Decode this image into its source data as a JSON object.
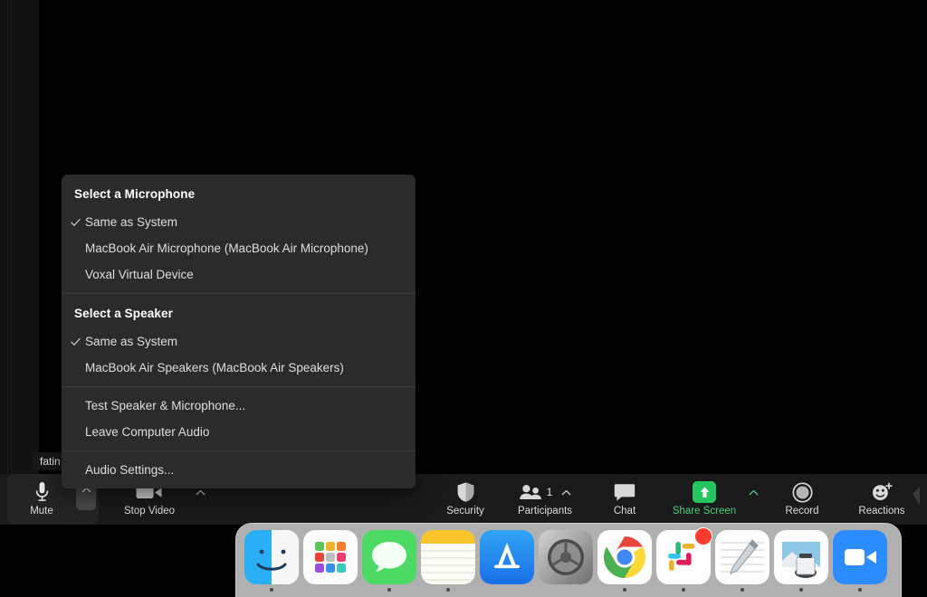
{
  "app": {
    "name": "Zoom Meeting",
    "participant_name_chip": "fatin"
  },
  "audio_menu": {
    "sections": [
      {
        "header": "Select a Microphone",
        "items": [
          {
            "label": "Same as System",
            "checked": true
          },
          {
            "label": "MacBook Air Microphone (MacBook Air Microphone)",
            "checked": false
          },
          {
            "label": "Voxal Virtual Device",
            "checked": false
          }
        ]
      },
      {
        "header": "Select a Speaker",
        "items": [
          {
            "label": "Same as System",
            "checked": true
          },
          {
            "label": "MacBook Air Speakers (MacBook Air Speakers)",
            "checked": false
          }
        ]
      },
      {
        "header": "",
        "items": [
          {
            "label": "Test Speaker & Microphone...",
            "checked": false
          },
          {
            "label": "Leave Computer Audio",
            "checked": false
          }
        ]
      },
      {
        "header": "",
        "items": [
          {
            "label": "Audio Settings...",
            "checked": false
          }
        ]
      }
    ]
  },
  "toolbar": {
    "mute": {
      "label": "Mute",
      "icon": "microphone-icon",
      "caret": "chevron-up-icon",
      "caret_active": true
    },
    "video": {
      "label": "Stop Video",
      "icon": "video-camera-icon",
      "caret": "chevron-up-icon"
    },
    "security": {
      "label": "Security",
      "icon": "shield-icon"
    },
    "participants": {
      "label": "Participants",
      "icon": "people-icon",
      "count": "1",
      "caret": "chevron-up-icon"
    },
    "chat": {
      "label": "Chat",
      "icon": "speech-bubble-icon"
    },
    "share_screen": {
      "label": "Share Screen",
      "icon": "up-arrow-icon",
      "caret": "chevron-up-icon",
      "accent": "#22c55e"
    },
    "record": {
      "label": "Record",
      "icon": "record-circle-icon"
    },
    "reactions": {
      "label": "Reactions",
      "icon": "smiley-plus-icon"
    }
  },
  "dock": {
    "apps": [
      {
        "name": "Finder",
        "running": true
      },
      {
        "name": "Launchpad",
        "running": false
      },
      {
        "name": "Messages",
        "running": true
      },
      {
        "name": "Notes",
        "running": true
      },
      {
        "name": "App Store",
        "running": false
      },
      {
        "name": "System Preferences",
        "running": false
      },
      {
        "name": "Google Chrome",
        "running": true
      },
      {
        "name": "Slack",
        "running": true,
        "badge": true
      },
      {
        "name": "TextEdit",
        "running": true
      },
      {
        "name": "Preview",
        "running": true
      },
      {
        "name": "Zoom",
        "running": true
      }
    ]
  },
  "colors": {
    "menu_bg": "#2b2b2b",
    "toolbar_bg": "#1a1a1a",
    "share_green": "#22c55e",
    "badge_red": "#ff3b30"
  }
}
